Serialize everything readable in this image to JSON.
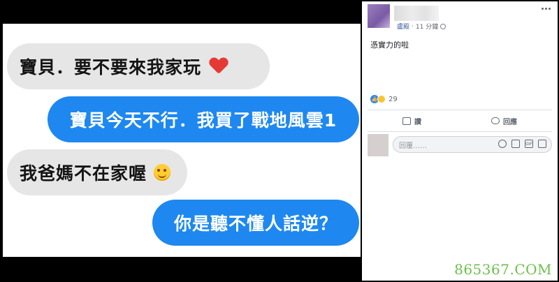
{
  "chat": {
    "messages": [
      {
        "side": "in",
        "text": "寶貝．要不要來我家玩",
        "emoji": "heart-icon"
      },
      {
        "side": "out",
        "text": "寶貝今天不行．我買了戰地風雲1"
      },
      {
        "side": "in",
        "text": "我爸媽不在家喔",
        "emoji": "smile-icon"
      },
      {
        "side": "out",
        "text": "你是聽不懂人話逆？"
      }
    ]
  },
  "post": {
    "author": "盧殿",
    "time": "11 分鐘",
    "text": "憑實力的啦",
    "reaction_count": "29",
    "like_label": "讚",
    "comment_label": "回應",
    "comment_placeholder": "回覆……"
  },
  "watermark": "865367.COM",
  "colors": {
    "outgoing_bubble": "#1e88f0",
    "incoming_bubble": "#e6e6e6",
    "watermark": "#6cc04a",
    "fb_link": "#385898"
  }
}
